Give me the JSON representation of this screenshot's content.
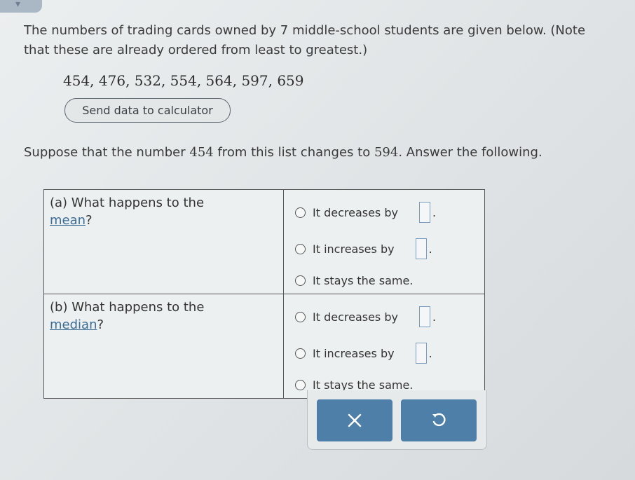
{
  "problem": {
    "intro": "The numbers of trading cards owned by 7 middle-school students are given below. (Note that these are already ordered from least to greatest.)",
    "data_list": "454, 476, 532, 554, 564, 597, 659",
    "send_button_label": "Send data to calculator",
    "suppose_prefix": "Suppose that the number ",
    "old_value": "454",
    "suppose_middle": " from this list changes to ",
    "new_value": "594",
    "suppose_suffix": ". Answer the following."
  },
  "questions": [
    {
      "label_prefix": "(a)  What happens to the",
      "keyword": "mean",
      "label_suffix": "?",
      "options": [
        "It decreases by",
        "It increases by",
        "It stays the same."
      ]
    },
    {
      "label_prefix": "(b)  What happens to the",
      "keyword": "median",
      "label_suffix": "?",
      "options": [
        "It decreases by",
        "It increases by",
        "It stays the same."
      ]
    }
  ],
  "punct": {
    "period": "."
  },
  "actions": {
    "clear_icon": "x-icon",
    "reset_icon": "undo-icon",
    "button_color": "#4e7fa8"
  }
}
